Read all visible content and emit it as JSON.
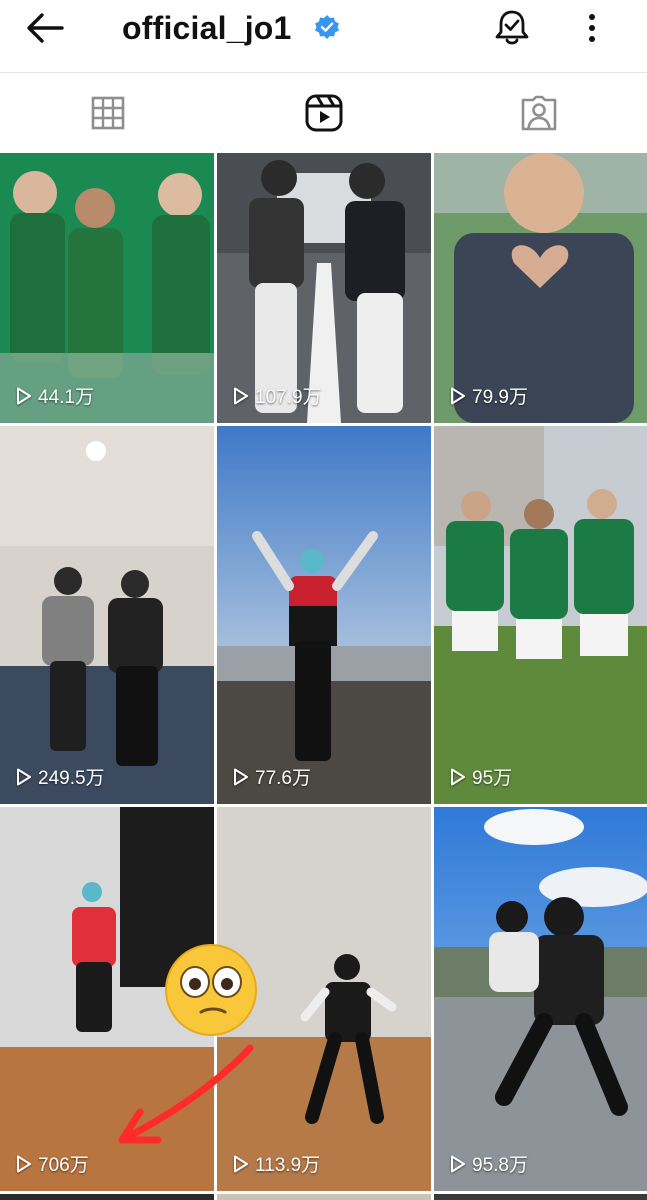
{
  "header": {
    "username": "official_jo1",
    "verified": true,
    "icons": [
      "back-arrow-icon",
      "verified-badge-icon",
      "notification-bell-icon",
      "more-vertical-icon"
    ]
  },
  "tabs": [
    {
      "name": "posts",
      "icon": "grid-icon",
      "active": false
    },
    {
      "name": "reels",
      "icon": "reels-icon",
      "active": true
    },
    {
      "name": "tagged",
      "icon": "tagged-person-icon",
      "active": false
    }
  ],
  "reels": [
    {
      "views": "44.1万"
    },
    {
      "views": "107.9万"
    },
    {
      "views": "79.9万"
    },
    {
      "views": "249.5万"
    },
    {
      "views": "77.6万"
    },
    {
      "views": "95万"
    },
    {
      "views": "706万"
    },
    {
      "views": "113.9万"
    },
    {
      "views": "95.8万"
    }
  ],
  "annotations": {
    "emoji": "flushed-face-emoji",
    "arrow": "red-hand-drawn-arrow",
    "arrow_color": "#ff2a2a"
  },
  "colors": {
    "verified": "#3797f0",
    "icon": "#262626",
    "inactive_icon": "#8e8e8e"
  }
}
